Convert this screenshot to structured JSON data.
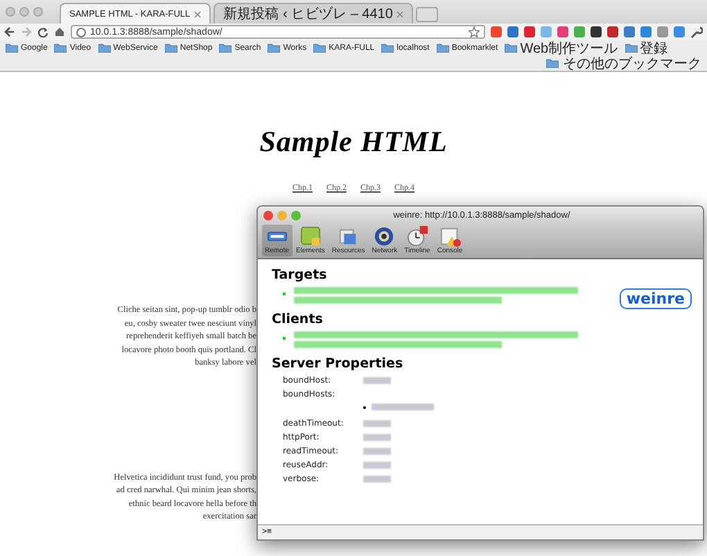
{
  "browser": {
    "tabs": [
      {
        "title": "SAMPLE HTML - KARA-FULL",
        "selected": true
      },
      {
        "title": "新規投稿 ‹ ヒビヅレ – 4410",
        "selected": false
      }
    ],
    "address": "10.0.1.3:8888/sample/shadow/",
    "bookmarks": [
      "Google",
      "Video",
      "WebService",
      "NetShop",
      "Search",
      "Works",
      "KARA-FULL",
      "localhost",
      "Bookmarklet",
      "Web制作ツール",
      "登録"
    ],
    "other_bookmarks": "その他のブックマーク"
  },
  "page": {
    "title": "Sample HTML",
    "nav": [
      "Chp.1",
      "Chp.2",
      "Chp.3",
      "Chp.4"
    ],
    "paragraphs": [
      [
        "Cliche seitan sint, pop-up tumblr odio b",
        "eu, cosby sweater twee nesciunt vinyl",
        "reprehenderit keffiyeh small batch be",
        "locavore photo booth quis portland. Cl",
        "banksy labore vel"
      ],
      [
        "Helvetica incididunt trust fund, you prob",
        "ad cred narwhal. Qui minim jean shorts,",
        "ethnic beard locavore hella before th",
        "exercitation sar"
      ]
    ]
  },
  "inspector": {
    "title": "weinre: http://10.0.1.3:8888/sample/shadow/",
    "tools": [
      {
        "label": "Remote",
        "selected": true
      },
      {
        "label": "Elements",
        "selected": false
      },
      {
        "label": "Resources",
        "selected": false
      },
      {
        "label": "Network",
        "selected": false
      },
      {
        "label": "Timeline",
        "selected": false
      },
      {
        "label": "Console",
        "selected": false
      }
    ],
    "sections": [
      {
        "heading": "Targets"
      },
      {
        "heading": "Clients"
      }
    ],
    "badge": "weinre",
    "server_heading": "Server Properties",
    "properties": [
      {
        "name": "boundHost:",
        "kind": "value"
      },
      {
        "name": "boundHosts:",
        "kind": "list"
      },
      {
        "name": "deathTimeout:",
        "kind": "value"
      },
      {
        "name": "httpPort:",
        "kind": "value"
      },
      {
        "name": "readTimeout:",
        "kind": "value"
      },
      {
        "name": "reuseAddr:",
        "kind": "value"
      },
      {
        "name": "verbose:",
        "kind": "value"
      }
    ],
    "console_prompt": ">≡"
  }
}
